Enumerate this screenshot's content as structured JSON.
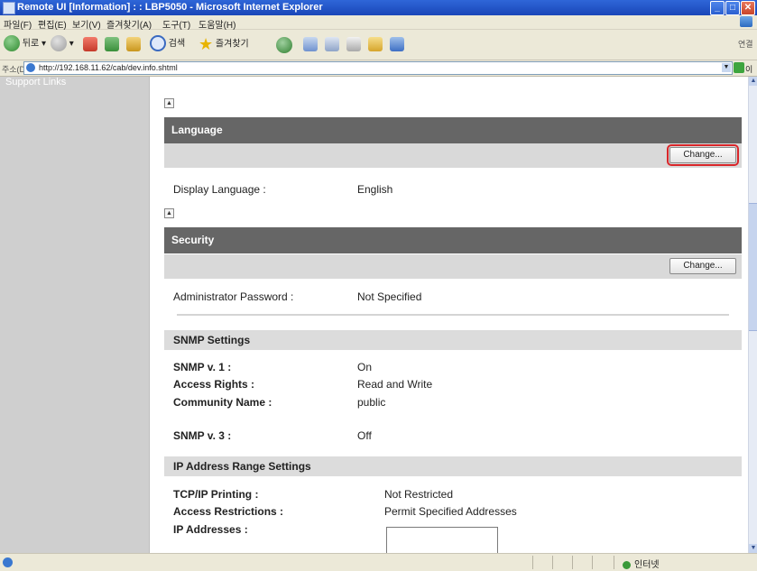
{
  "window": {
    "title": "Remote UI [Information] : : LBP5050 - Microsoft Internet Explorer",
    "controls": {
      "minimize": "_",
      "maximize": "□",
      "close": "✕"
    }
  },
  "menu": {
    "items": [
      "파일(F)",
      "편집(E)",
      "보기(V)",
      "즐겨찾기(A)",
      "도구(T)",
      "도움말(H)"
    ]
  },
  "toolbar": {
    "back_label": "뒤로",
    "search_label": "검색",
    "favorites_label": "즐겨찾기",
    "links_label": "연결"
  },
  "address": {
    "label": "주소(D)",
    "url": "http://192.168.11.62/cab/dev.info.shtml",
    "go_label": "이동"
  },
  "sidebar": {
    "link": "Support Links"
  },
  "icons": {
    "collapse": "▲",
    "scroll_up": "▲",
    "scroll_down": "▼"
  },
  "language_section": {
    "title": "Language",
    "change_label": "Change...",
    "fields": [
      {
        "label": "Display Language :",
        "value": "English"
      }
    ]
  },
  "security_section": {
    "title": "Security",
    "change_label": "Change...",
    "fields": [
      {
        "label": "Administrator Password :",
        "value": "Not Specified"
      }
    ],
    "snmp": {
      "title": "SNMP Settings",
      "fields": [
        {
          "label": "SNMP v. 1 :",
          "value": "On"
        },
        {
          "label": "Access Rights :",
          "value": "Read and Write"
        },
        {
          "label": "Community Name :",
          "value": "public"
        },
        {
          "label": "SNMP v. 3 :",
          "value": "Off"
        }
      ]
    },
    "ip_range": {
      "title": "IP Address Range Settings",
      "fields": [
        {
          "label": "TCP/IP Printing :",
          "value": "Not Restricted"
        },
        {
          "label": "Access Restrictions :",
          "value": "Permit Specified Addresses"
        },
        {
          "label": "IP Addresses :",
          "value": ""
        }
      ]
    }
  },
  "status": {
    "zone": "인터넷"
  }
}
